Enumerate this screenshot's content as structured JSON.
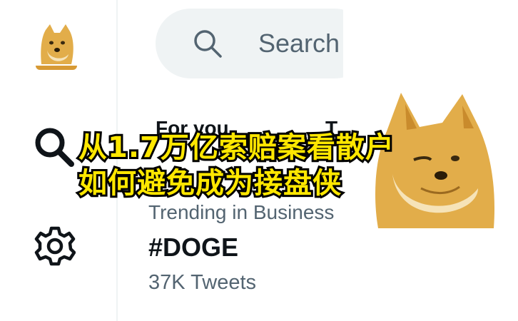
{
  "search": {
    "placeholder": "Search"
  },
  "tabs": {
    "for_you": "For you",
    "trending": "T"
  },
  "trend": {
    "context": "Trending in Business",
    "name": "#DOGE",
    "count": "37K Tweets"
  },
  "overlay": {
    "line1": "从1.7万亿索赔案看散户",
    "line2": "如何避免成为接盘侠"
  },
  "colors": {
    "overlay_text": "#ffe700",
    "overlay_stroke": "#000000",
    "doge_fur": "#e2ad4a",
    "search_bg": "#eff3f4",
    "muted_text": "#536471"
  },
  "icons": {
    "avatar": "doge-avatar-icon",
    "nav_search": "search-icon",
    "nav_settings": "gear-icon",
    "field_search": "search-icon"
  }
}
